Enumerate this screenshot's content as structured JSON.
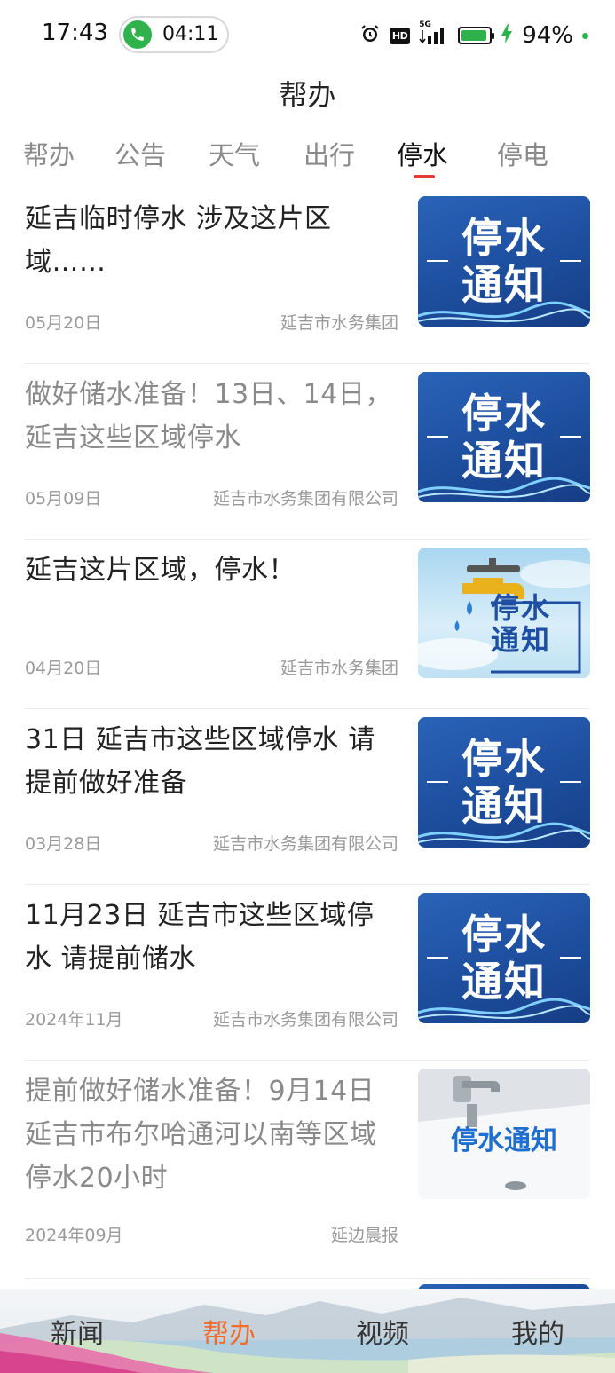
{
  "status_bar": {
    "time": "17:43",
    "call_timer": "04:11",
    "hd_label": "HD",
    "network_label": "5G",
    "battery_percent": 94,
    "battery_text": "94%"
  },
  "page": {
    "title": "帮办"
  },
  "tabs": [
    {
      "label": "帮办",
      "active": false
    },
    {
      "label": "公告",
      "active": false
    },
    {
      "label": "天气",
      "active": false
    },
    {
      "label": "出行",
      "active": false
    },
    {
      "label": "停水",
      "active": true
    },
    {
      "label": "停电",
      "active": false
    }
  ],
  "articles": [
    {
      "title": "延吉临时停水 涉及这片区域……",
      "date": "05月20日",
      "source": "延吉市水务集团",
      "read": false,
      "thumb": "blue",
      "thumb_text": [
        "停水",
        "通知"
      ]
    },
    {
      "title": "做好储水准备！13日、14日，延吉这些区域停水",
      "date": "05月09日",
      "source": "延吉市水务集团有限公司",
      "read": true,
      "thumb": "blue",
      "thumb_text": [
        "停水",
        "通知"
      ]
    },
    {
      "title": "延吉这片区域，停水！",
      "date": "04月20日",
      "source": "延吉市水务集团",
      "read": false,
      "thumb": "sky",
      "thumb_text": [
        "停水",
        "通知"
      ]
    },
    {
      "title": "31日 延吉市这些区域停水 请提前做好准备",
      "date": "03月28日",
      "source": "延吉市水务集团有限公司",
      "read": false,
      "thumb": "blue",
      "thumb_text": [
        "停水",
        "通知"
      ]
    },
    {
      "title": "11月23日 延吉市这些区域停水 请提前储水",
      "date": "2024年11月",
      "source": "延吉市水务集团有限公司",
      "read": false,
      "thumb": "blue",
      "thumb_text": [
        "停水",
        "通知"
      ]
    },
    {
      "title": "提前做好储水准备！9月14日延吉市布尔哈通河以南等区域停水20小时",
      "date": "2024年09月",
      "source": "延边晨报",
      "read": true,
      "thumb": "sink",
      "thumb_text": [
        "停水通知"
      ]
    }
  ],
  "bottom_nav": [
    {
      "label": "新闻",
      "active": false
    },
    {
      "label": "帮办",
      "active": true
    },
    {
      "label": "视频",
      "active": false
    },
    {
      "label": "我的",
      "active": false
    }
  ],
  "colors": {
    "accent_red": "#e53935",
    "active_nav_orange": "#ef6c2a",
    "call_green": "#2fb24c",
    "thumb_blue": "#1d4e9e"
  },
  "icons": [
    "phone-icon",
    "alarm-icon",
    "signal-icon",
    "battery-icon",
    "charging-icon"
  ]
}
